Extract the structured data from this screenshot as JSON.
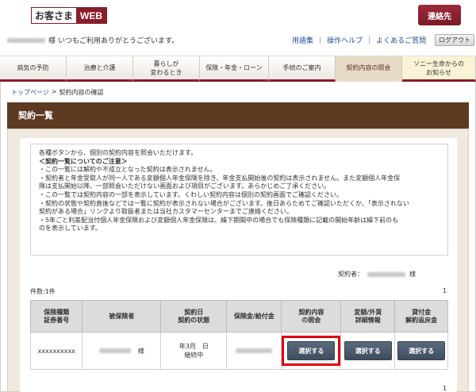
{
  "header": {
    "logo_jp": "お客さま",
    "logo_web": "WEB",
    "contact_label": "連絡先",
    "welcome_suffix": "様",
    "welcome_text": "いつもご利用ありがとうございます。",
    "links": [
      "用語集",
      "操作ヘルプ",
      "よくあるご質問"
    ],
    "logout_label": "ログアウト"
  },
  "nav": {
    "items": [
      {
        "label": "病気の予防"
      },
      {
        "label": "治療と介護"
      },
      {
        "label": "暮らしが\n変わるとき"
      },
      {
        "label": "保険・年金・ローン"
      },
      {
        "label": "手続のご案内"
      },
      {
        "label": "契約内容の照会"
      },
      {
        "label": "ソニー生命からの\nお知らせ"
      }
    ]
  },
  "breadcrumb": {
    "top": "トップページ",
    "sep": ">",
    "current": "契約内容の確認"
  },
  "page_title": "契約一覧",
  "notice": {
    "intro": "各種ボタンから、個別の契約内容を照会いただけます。",
    "heading": "＜契約一覧についてのご注意＞",
    "lines": [
      "・この一覧には解約や不成立となった契約は表示されません。",
      "・契約者と年金受取人が同一人である変額個人年金保険を除き、年金支払開始後の契約は表示されません。また変額個人年金保",
      "険は支払開始以降、一部照会いただけない画面および項目がございます。あらかじめご了承ください。",
      "・この一覧では契約内容の一部を表示しています。くわしい契約内容は個別の契約画面でご確認ください。",
      "・契約の状態や契約直後などでは一覧に契約が表示されない場合がございます。後日あらためてご確認いただくか、「表示されない",
      "契約がある場合」リンクより取扱者または当社カスタマーセンターまでご連絡ください。",
      "・5年ごと利差配当付個人年金保険および変額個人年金保険は、繰下期間中の場合でも保険種類に記載の開始年齢は繰下前のも",
      "のを表示しています。"
    ]
  },
  "contractor": {
    "label": "契約者：",
    "suffix": "様"
  },
  "count_label": "件数:1件",
  "page_number": "1",
  "table": {
    "headers": [
      "保険種類\n証券番号",
      "被保険者",
      "契約日\n契約の状態",
      "保険金/給付金",
      "契約内容\nの照会",
      "変額/外貨\n詳細情報",
      "貸付金\n解約返戻金"
    ],
    "row": {
      "policy": "xxxxxxxxxx",
      "insured_suffix": "様",
      "contract_date": "年3月　日",
      "status": "継続中",
      "btn1": "選択する",
      "btn2": "選択する",
      "btn3": "選択する"
    }
  },
  "colors": {
    "brand": "#8b1d2c",
    "title_band": "#5c3a22",
    "highlight": "#e00012"
  }
}
